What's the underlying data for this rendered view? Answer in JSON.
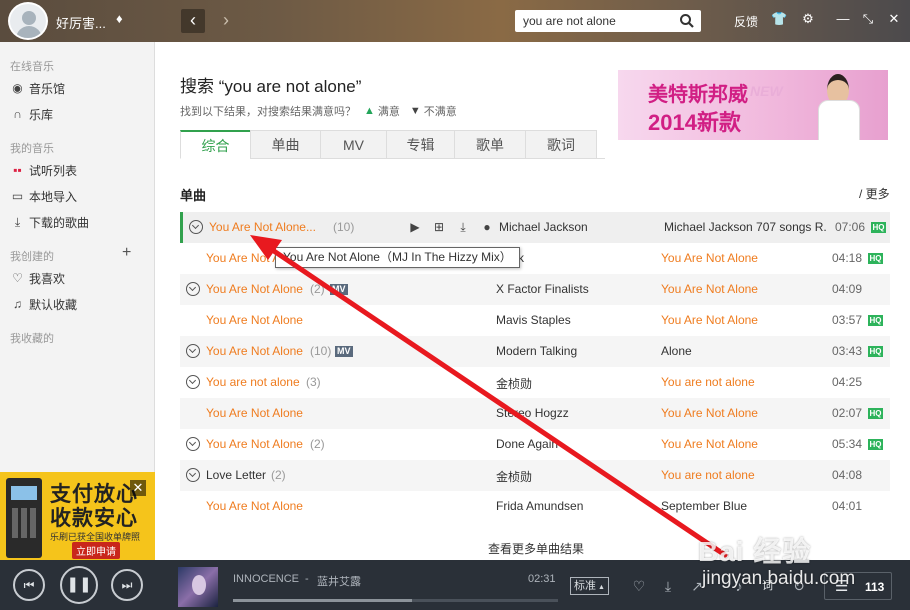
{
  "topbar": {
    "username": "好厉害...",
    "search_value": "you are not alone",
    "feedback": "反馈"
  },
  "sidebar": {
    "sections": {
      "online": "在线音乐",
      "mine": "我的音乐",
      "created": "我创建的",
      "collected": "我收藏的"
    },
    "items": {
      "music_hall": "音乐馆",
      "library": "乐库",
      "trial_list": "试听列表",
      "local_import": "本地导入",
      "downloaded": "下载的歌曲",
      "favorites": "我喜欢",
      "default_collection": "默认收藏"
    },
    "ad": {
      "line1": "支付放心",
      "line2": "收款安心",
      "line3": "乐刷已获全国收单牌照",
      "button": "立即申请"
    }
  },
  "main": {
    "title": "搜索 “you are not alone”",
    "subtitle": "找到以下结果，对搜索结果满意吗？",
    "satisfied": "满意",
    "unsatisfied": "不满意",
    "banner": {
      "line1": "美特斯邦威",
      "line2": "2014新款",
      "new": "NEW"
    },
    "tabs": [
      "综合",
      "单曲",
      "MV",
      "专辑",
      "歌单",
      "歌词"
    ],
    "section_title": "单曲",
    "more": "/ 更多",
    "songs": [
      {
        "title": "You Are Not Alone...",
        "count": "(10)",
        "mv": "",
        "artist": "Michael Jackson",
        "album": "Michael Jackson 707 songs R.",
        "duration": "07:06",
        "hq": "HQ"
      },
      {
        "title": "You Are Not Alone",
        "count": "",
        "mv": "",
        "artist": "Majik",
        "album": "You Are Not Alone",
        "duration": "04:18",
        "hq": "HQ"
      },
      {
        "title": "You Are Not Alone",
        "count": "(2)",
        "mv": "MV",
        "artist": "X Factor Finalists",
        "album": "You Are Not Alone",
        "duration": "04:09",
        "hq": ""
      },
      {
        "title": "You Are Not Alone",
        "count": "",
        "mv": "",
        "artist": "Mavis Staples",
        "album": "You Are Not Alone",
        "duration": "03:57",
        "hq": "HQ"
      },
      {
        "title": "You Are Not Alone",
        "count": "(10)",
        "mv": "MV",
        "artist": "Modern Talking",
        "album": "Alone",
        "duration": "03:43",
        "hq": "HQ"
      },
      {
        "title": "You are not alone",
        "count": "(3)",
        "mv": "",
        "artist": "金桢勋",
        "album": "You are not alone",
        "duration": "04:25",
        "hq": ""
      },
      {
        "title": "You Are Not Alone",
        "count": "",
        "mv": "",
        "artist": "Stereo Hogzz",
        "album": "You Are Not Alone",
        "duration": "02:07",
        "hq": "HQ"
      },
      {
        "title": "You Are Not Alone",
        "count": "(2)",
        "mv": "",
        "artist": "Done Again",
        "album": "You Are Not Alone",
        "duration": "05:34",
        "hq": "HQ"
      },
      {
        "title": "Love Letter",
        "count": "(2)",
        "mv": "",
        "artist": "金桢勋",
        "album": "You are not alone",
        "duration": "04:08",
        "hq": ""
      },
      {
        "title": "You Are Not Alone",
        "count": "",
        "mv": "",
        "artist": "Frida Amundsen",
        "album": "September Blue",
        "duration": "04:01",
        "hq": ""
      }
    ],
    "tooltip": "You Are Not Alone（MJ In The Hizzy Mix）",
    "see_more": "查看更多单曲结果"
  },
  "player": {
    "song": "INNOCENCE",
    "separator": "-",
    "artist": "蓝井艾露",
    "time": "02:31",
    "progress": 0.55,
    "quality": "标准",
    "lyric": "词",
    "playlist_count": "113"
  },
  "watermark": {
    "logo": "Bai  经验",
    "url": "jingyan.baidu.com"
  },
  "colors": {
    "accent_green": "#31a14d",
    "song_orange": "#ef7c1f",
    "arrow_red": "#e8191f",
    "player_bg": "#2a3038"
  }
}
